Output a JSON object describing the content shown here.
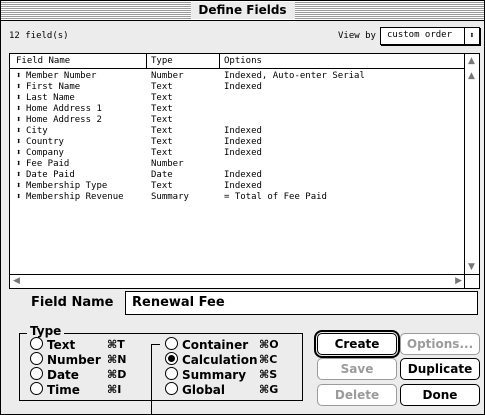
{
  "window": {
    "title": "Define Fields"
  },
  "header": {
    "field_count": "12 field(s)",
    "view_by_label": "View by",
    "view_by_value": "custom order"
  },
  "table": {
    "columns": [
      "Field Name",
      "Type",
      "Options"
    ],
    "rows": [
      {
        "name": "Member Number",
        "type": "Number",
        "options": "Indexed, Auto-enter Serial"
      },
      {
        "name": "First Name",
        "type": "Text",
        "options": "Indexed"
      },
      {
        "name": "Last Name",
        "type": "Text",
        "options": ""
      },
      {
        "name": "Home Address 1",
        "type": "Text",
        "options": ""
      },
      {
        "name": "Home Address 2",
        "type": "Text",
        "options": ""
      },
      {
        "name": "City",
        "type": "Text",
        "options": "Indexed"
      },
      {
        "name": "Country",
        "type": "Text",
        "options": "Indexed"
      },
      {
        "name": "Company",
        "type": "Text",
        "options": "Indexed"
      },
      {
        "name": "Fee Paid",
        "type": "Number",
        "options": ""
      },
      {
        "name": "Date Paid",
        "type": "Date",
        "options": "Indexed"
      },
      {
        "name": "Membership Type",
        "type": "Text",
        "options": "Indexed"
      },
      {
        "name": "Membership Revenue",
        "type": "Summary",
        "options": "= Total of Fee Paid"
      }
    ]
  },
  "field_name": {
    "label": "Field Name",
    "value": "Renewal Fee"
  },
  "type_group": {
    "label": "Type",
    "options": [
      {
        "label": "Text",
        "key": "⌘T",
        "selected": false
      },
      {
        "label": "Number",
        "key": "⌘N",
        "selected": false
      },
      {
        "label": "Date",
        "key": "⌘D",
        "selected": false
      },
      {
        "label": "Time",
        "key": "⌘I",
        "selected": false
      },
      {
        "label": "Container",
        "key": "⌘O",
        "selected": false
      },
      {
        "label": "Calculation",
        "key": "⌘C",
        "selected": true
      },
      {
        "label": "Summary",
        "key": "⌘S",
        "selected": false
      },
      {
        "label": "Global",
        "key": "⌘G",
        "selected": false
      }
    ]
  },
  "buttons": {
    "create": "Create",
    "options": "Options...",
    "save": "Save",
    "duplicate": "Duplicate",
    "delete": "Delete",
    "done": "Done"
  },
  "icons": {
    "row_marker": "⬍",
    "popup_arrow": "⬍",
    "scroll_up": "▲",
    "scroll_down": "▼",
    "scroll_left": "◀",
    "scroll_right": "▶"
  }
}
